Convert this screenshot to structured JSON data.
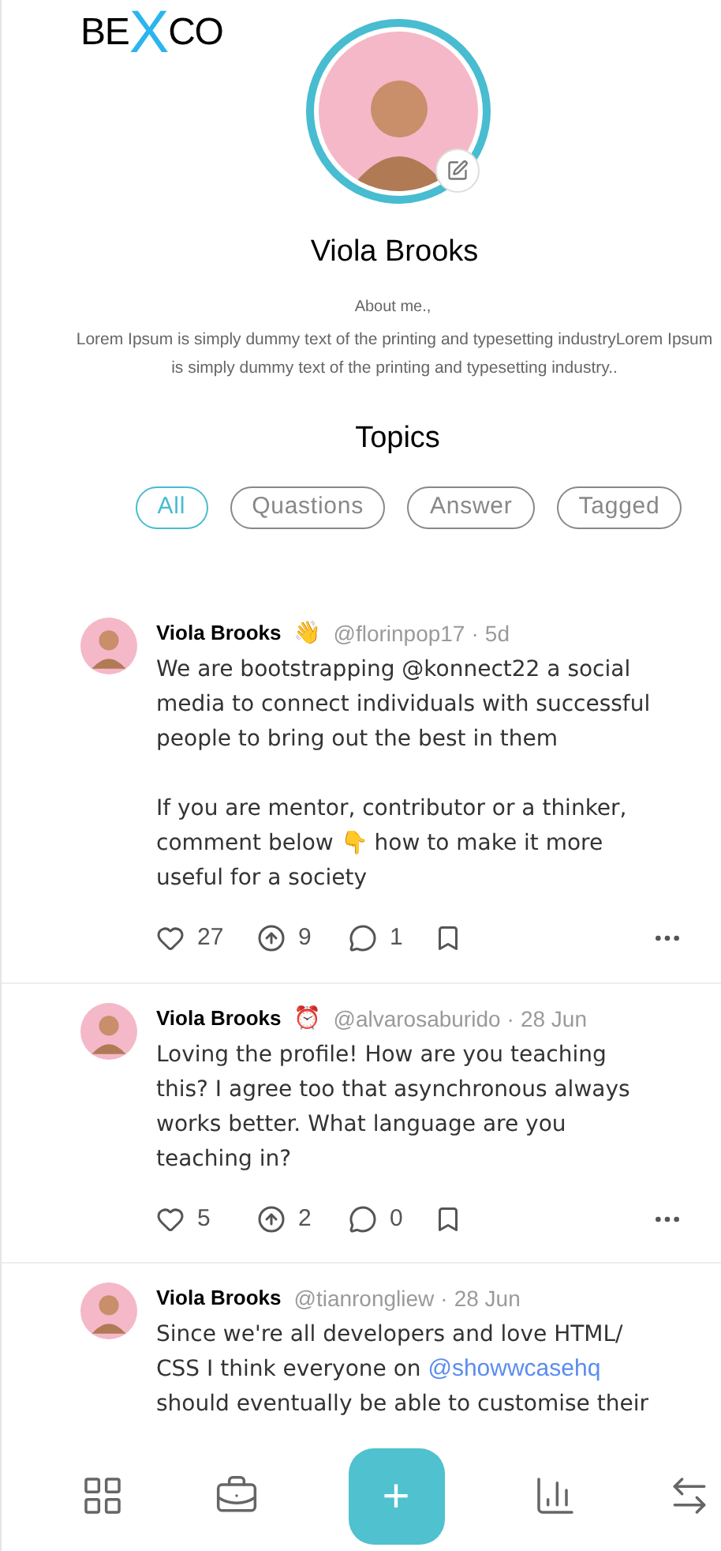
{
  "logo": {
    "before": "BE",
    "mark": "X",
    "after": "CO"
  },
  "profile": {
    "name": "Viola Brooks",
    "about_label": "About me.,",
    "about": "Lorem Ipsum is simply dummy text of the printing and typesetting industryLorem Ipsum is simply dummy text of the printing and typesetting industry.."
  },
  "topics": {
    "title": "Topics",
    "tabs": [
      {
        "label": "All",
        "selected": true
      },
      {
        "label": "Quastions",
        "selected": false
      },
      {
        "label": "Answer",
        "selected": false
      },
      {
        "label": "Tagged",
        "selected": false
      }
    ]
  },
  "posts": [
    {
      "author": "Viola Brooks",
      "emoji": "👋",
      "handle": "@florinpop17",
      "time": "5d",
      "paragraphs": [
        [
          {
            "kind": "text",
            "text": "We are bootstrapping @konnect22 a social media to connect individuals with successful people to bring out the best in them"
          }
        ],
        [
          {
            "kind": "text",
            "text": "If you are mentor, contributor or a thinker, comment below 👇 how to make it more useful for a society"
          }
        ]
      ],
      "likes": "27",
      "upvotes": "9",
      "comments": "1"
    },
    {
      "author": "Viola Brooks",
      "emoji": "⏰",
      "handle": "@alvarosaburido",
      "time": "28 Jun",
      "paragraphs": [
        [
          {
            "kind": "text",
            "text": "Loving the profile! How are you teaching this? I agree too that asynchronous always works better. What language are you teaching in?"
          }
        ]
      ],
      "likes": "5",
      "upvotes": "2",
      "comments": "0"
    },
    {
      "author": "Viola Brooks",
      "handle": "@tianrongliew",
      "time": "28 Jun",
      "paragraphs": [
        [
          {
            "kind": "text",
            "text": "Since we're all developers and love HTML/ CSS I think everyone on "
          },
          {
            "kind": "mention",
            "text": "@showwcasehq"
          },
          {
            "kind": "text",
            "text": " should eventually be able to customise their"
          }
        ]
      ]
    }
  ],
  "separator": "·",
  "fab": {
    "label": "+"
  }
}
